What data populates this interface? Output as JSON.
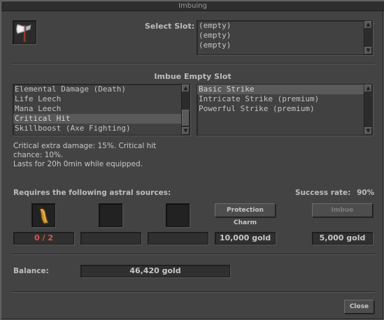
{
  "window": {
    "title": "Imbuing"
  },
  "item": {
    "icon": "axe-icon"
  },
  "select_slot": {
    "label": "Select Slot:",
    "options": [
      "(empty)",
      "(empty)",
      "(empty)"
    ]
  },
  "imbue_section": {
    "title": "Imbue Empty Slot"
  },
  "imbuement_types": [
    "Elemental Damage (Death)",
    "Life Leech",
    "Mana Leech",
    "Critical Hit",
    "Skillboost (Axe Fighting)"
  ],
  "imbuement_types_selected": 3,
  "imbuement_tiers": [
    "Basic Strike",
    "Intricate Strike (premium)",
    "Powerful Strike (premium)"
  ],
  "imbuement_tiers_selected": 0,
  "description": {
    "line1": "Critical extra damage: 15%. Critical hit",
    "line2": "chance: 10%.",
    "line3": "Lasts for 20h 0min while equipped."
  },
  "requirements": {
    "label": "Requires the following astral sources:",
    "success_label": "Success rate:",
    "success_value": "90%",
    "source_icon": "protective-charm-icon",
    "source_count": "0 / 2"
  },
  "protection_charm": {
    "label": "Protection Charm",
    "cost": "10,000 gold"
  },
  "imbue": {
    "label": "Imbue",
    "cost": "5,000 gold"
  },
  "balance": {
    "label": "Balance:",
    "value": "46,420 gold"
  },
  "close_label": "Close",
  "colors": {
    "window_bg": "#434343",
    "required_count": "#e0573e"
  }
}
